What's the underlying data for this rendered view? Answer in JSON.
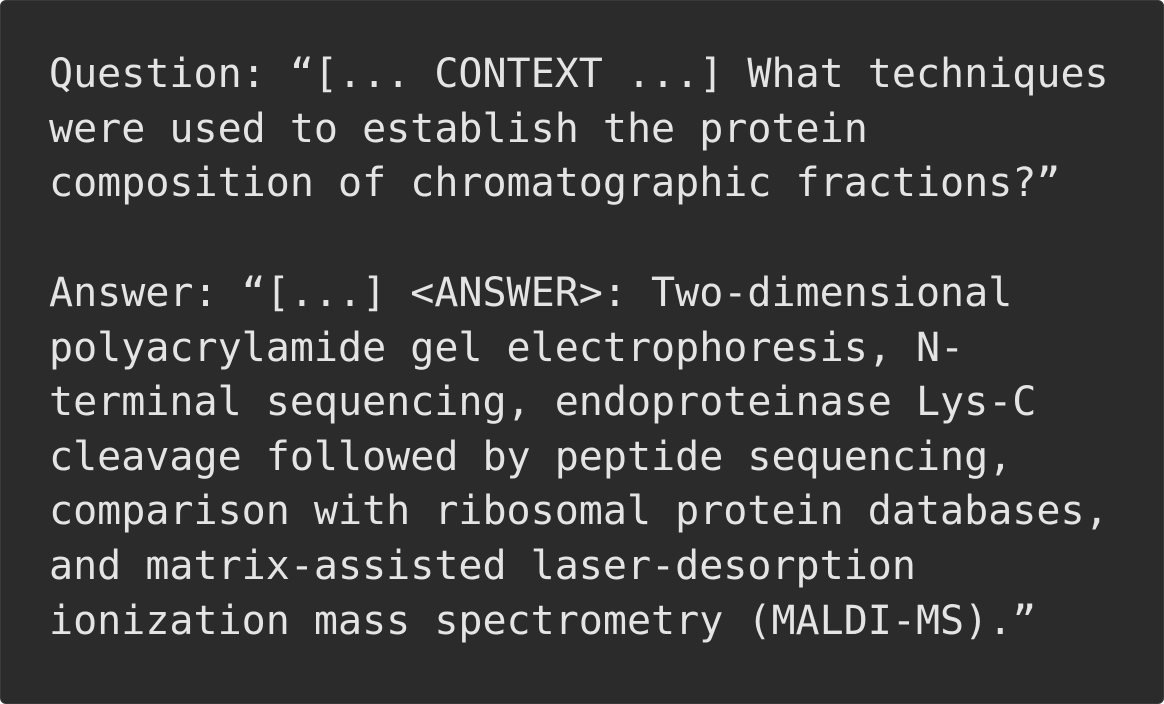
{
  "question": {
    "lines": [
      "Question: “[... CONTEXT ...] What techniques",
      "were used to establish the protein",
      "composition of chromatographic fractions?”"
    ]
  },
  "answer": {
    "lines": [
      "Answer: “[...] <ANSWER>: Two-dimensional",
      "polyacrylamide gel electrophoresis, N-",
      "terminal sequencing, endoproteinase Lys-C",
      "cleavage followed by peptide sequencing,",
      "comparison with ribosomal protein databases,",
      "and matrix-assisted laser-desorption",
      "ionization mass spectrometry (MALDI-MS).”"
    ]
  }
}
